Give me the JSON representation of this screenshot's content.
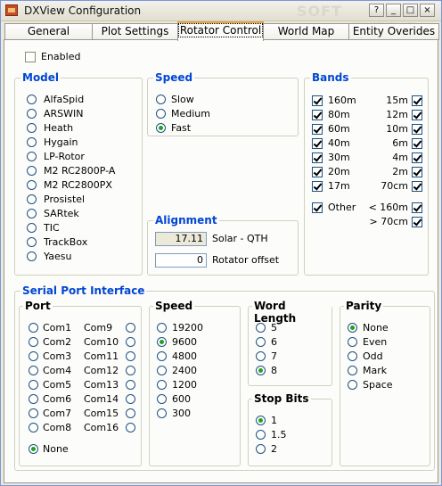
{
  "window": {
    "title": "DXView Configuration",
    "watermark": "SOFT",
    "watermark_url": "www.softpedia.com"
  },
  "tabs": [
    "General",
    "Plot Settings",
    "Rotator Control",
    "World Map",
    "Entity Overides"
  ],
  "enabled": {
    "label": "Enabled",
    "checked": false
  },
  "model": {
    "title": "Model",
    "options": [
      "AlfaSpid",
      "ARSWIN",
      "Heath",
      "Hygain",
      "LP-Rotor",
      "M2 RC2800P-A",
      "M2 RC2800PX",
      "Prosistel",
      "SARtek",
      "TIC",
      "TrackBox",
      "Yaesu"
    ]
  },
  "speed": {
    "title": "Speed",
    "options": [
      "Slow",
      "Medium",
      "Fast"
    ],
    "selected": "Fast"
  },
  "alignment": {
    "title": "Alignment",
    "solar_value": "17.11",
    "solar_label": "Solar - QTH",
    "offset_value": "0",
    "offset_label": "Rotator offset"
  },
  "bands": {
    "title": "Bands",
    "left": [
      "160m",
      "80m",
      "60m",
      "40m",
      "30m",
      "20m",
      "17m"
    ],
    "right": [
      "15m",
      "12m",
      "10m",
      "6m",
      "4m",
      "2m",
      "70cm"
    ],
    "other": "Other",
    "lt160": "< 160m",
    "gt70": "> 70cm"
  },
  "serial": {
    "title": "Serial Port Interface",
    "port": {
      "title": "Port",
      "col1": [
        "Com1",
        "Com2",
        "Com3",
        "Com4",
        "Com5",
        "Com6",
        "Com7",
        "Com8"
      ],
      "col2": [
        "Com9",
        "Com10",
        "Com11",
        "Com12",
        "Com13",
        "Com14",
        "Com15",
        "Com16"
      ],
      "none": "None",
      "selected": "None"
    },
    "speed": {
      "title": "Speed",
      "options": [
        "19200",
        "9600",
        "4800",
        "2400",
        "1200",
        "600",
        "300"
      ],
      "selected": "9600"
    },
    "word_length": {
      "title": "Word Length",
      "options": [
        "5",
        "6",
        "7",
        "8"
      ],
      "selected": "8"
    },
    "stop_bits": {
      "title": "Stop Bits",
      "options": [
        "1",
        "1.5",
        "2"
      ],
      "selected": "1"
    },
    "parity": {
      "title": "Parity",
      "options": [
        "None",
        "Even",
        "Odd",
        "Mark",
        "Space"
      ],
      "selected": "None"
    }
  },
  "colors": {
    "group_label": "#0046d5",
    "active_tab_top": "#e7a440",
    "radio_dot": "#21a121"
  }
}
